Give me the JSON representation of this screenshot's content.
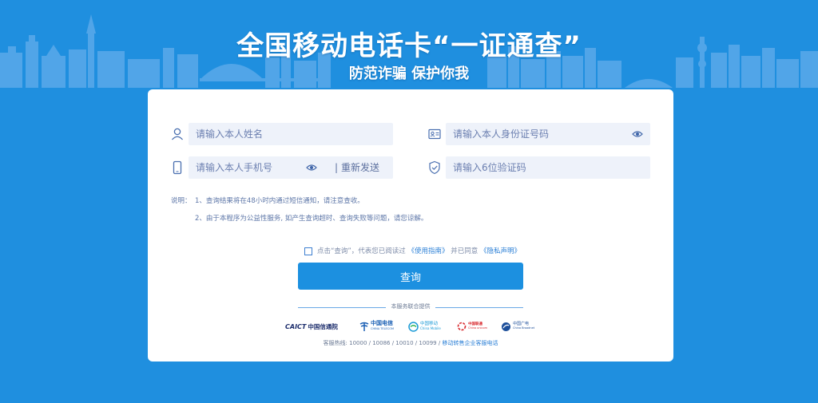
{
  "banner": {
    "title": "全国移动电话卡“一证通查”",
    "subtitle": "防范诈骗 保护你我"
  },
  "form": {
    "name": {
      "placeholder": "请输入本人姓名",
      "icon": "user-icon"
    },
    "id_number": {
      "placeholder": "请输入本人身份证号码",
      "icon": "id-card-icon"
    },
    "phone": {
      "placeholder": "请输入本人手机号",
      "icon": "phone-icon"
    },
    "resend_separator": "|",
    "resend_label": "重新发送",
    "code": {
      "placeholder": "请输入6位验证码",
      "icon": "shield-icon"
    }
  },
  "notes": {
    "label": "说明：",
    "items": [
      "1、查询结果将在48小时内通过短信通知，请注意查收。",
      "2、由于本程序为公益性服务, 如产生查询超时、查询失败等问题，请您谅解。"
    ]
  },
  "agreement": {
    "text_before": "点击“查询”，代表您已阅读过",
    "guide_link": "《使用指南》",
    "text_middle": "并已同意",
    "privacy_link": "《隐私声明》"
  },
  "submit_label": "查询",
  "provided_by": "本服务联合提供",
  "logos": {
    "caict_en": "CAICT",
    "caict_cn": "中国信通院",
    "telecom_cn": "中国电信",
    "telecom_en": "CHINA TELECOM",
    "mobile_cn": "中国移动",
    "mobile_en": "China Mobile",
    "unicom_cn": "中国联通",
    "unicom_en": "China unicom",
    "broadnet_cn": "中国广电",
    "broadnet_en": "China Broadnet"
  },
  "hotline": {
    "prefix": "客服热线: 10000 / 10086 / 10010 / 10099 /",
    "link": "移动转售企业客服电话"
  },
  "colors": {
    "background": "#1f8fdf",
    "field_bg": "#eef2fa",
    "button": "#1c90e0",
    "link": "#2a7fd6"
  }
}
